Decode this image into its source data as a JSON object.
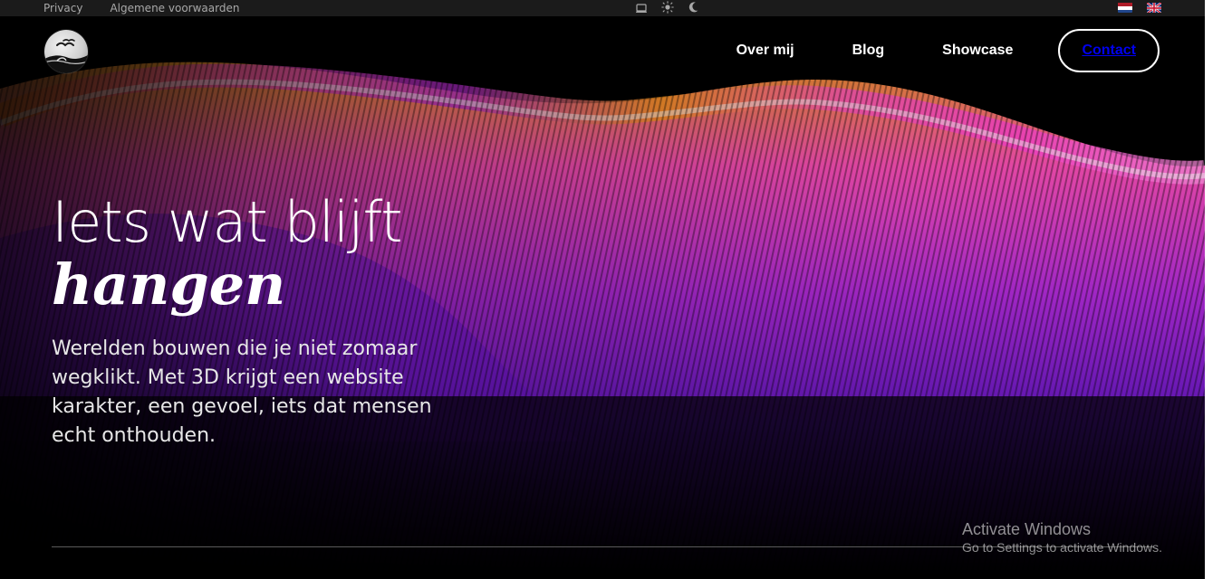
{
  "topbar": {
    "links": [
      "Privacy",
      "Algemene voorwaarden"
    ],
    "theme_icons": [
      "laptop-icon",
      "sun-icon",
      "moon-icon"
    ],
    "languages": [
      "Nederlands",
      "English"
    ]
  },
  "header": {
    "logo": "seagull-logo",
    "nav": {
      "over_mij": "Over mij",
      "blog": "Blog",
      "showcase": "Showcase",
      "contact": "Contact"
    }
  },
  "hero": {
    "title_line1": "Iets wat blijft",
    "title_line2": "hangen",
    "description": "Werelden bouwen die je niet zomaar wegklikt. Met 3D krijgt een website karakter, een gevoel, iets dat mensen echt onthouden."
  },
  "watermark": {
    "title": "Activate Windows",
    "subtitle": "Go to Settings to activate Windows."
  },
  "colors": {
    "background": "#000000",
    "wave_orange": "#ff8a2a",
    "wave_magenta": "#d42cc8",
    "wave_purple": "#7a1ad6",
    "text": "#ffffff"
  }
}
